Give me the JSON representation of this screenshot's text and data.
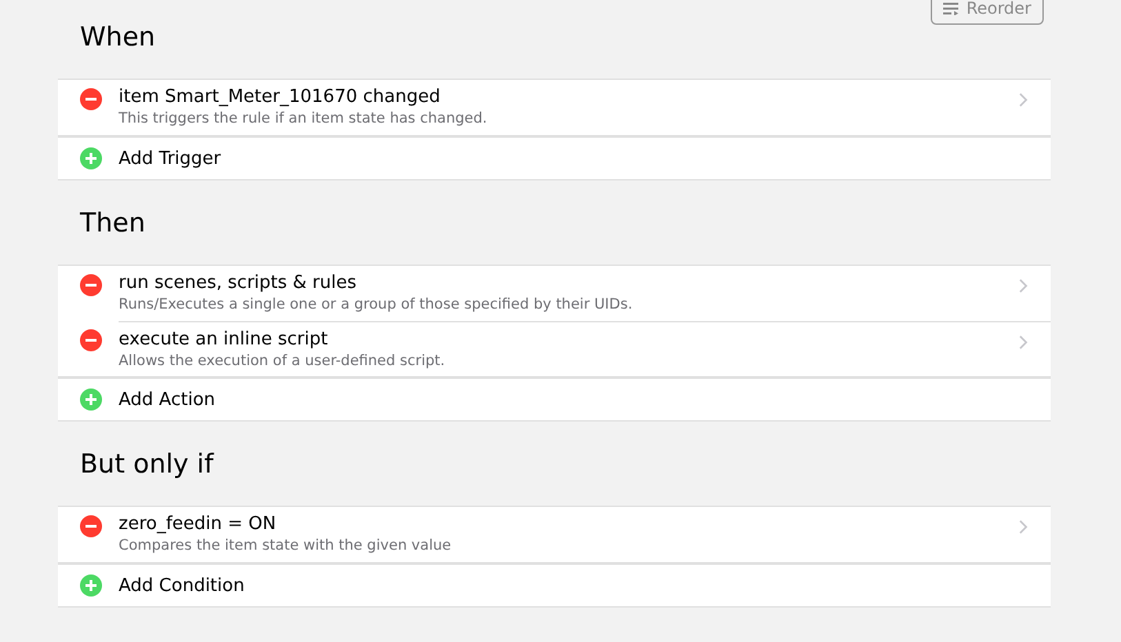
{
  "reorder_button": {
    "label": "Reorder"
  },
  "sections": [
    {
      "title": "When",
      "items": [
        {
          "title": "item Smart_Meter_101670 changed",
          "description": "This triggers the rule if an item state has changed."
        }
      ],
      "add_label": "Add Trigger"
    },
    {
      "title": "Then",
      "items": [
        {
          "title": "run scenes, scripts & rules",
          "description": "Runs/Executes a single one or a group of those specified by their UIDs."
        },
        {
          "title": "execute an inline script",
          "description": "Allows the execution of a user-defined script."
        }
      ],
      "add_label": "Add Action"
    },
    {
      "title": "But only if",
      "items": [
        {
          "title": "zero_feedin = ON",
          "description": "Compares the item state with the given value"
        }
      ],
      "add_label": "Add Condition"
    }
  ]
}
